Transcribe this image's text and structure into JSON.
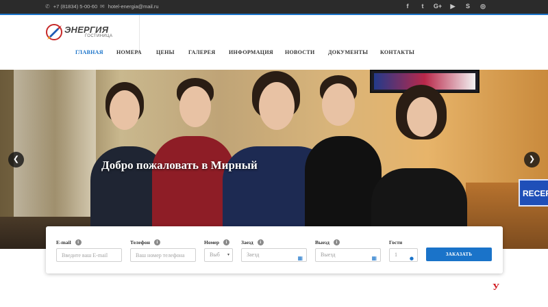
{
  "topbar": {
    "phone": "+7 (81834) 5-00-60",
    "email": "hotel-energia@mail.ru",
    "socials": [
      "f",
      "t",
      "G+",
      "▶",
      "S",
      "◎"
    ]
  },
  "logo": {
    "name": "ЭНЕРГИЯ",
    "subtitle": "ГОСТИНИЦА"
  },
  "nav": {
    "items": [
      "ГЛАВНАЯ",
      "НОМЕРА",
      "ЦЕНЫ",
      "ГАЛЕРЕЯ",
      "ИНФОРМАЦИЯ",
      "НОВОСТИ",
      "ДОКУМЕНТЫ",
      "КОНТАКТЫ"
    ],
    "active": "ГЛАВНАЯ"
  },
  "hero": {
    "title": "Добро пожаловать в Мирный",
    "reception_sign": "RECEP"
  },
  "booking": {
    "email_label": "E-mail",
    "email_placeholder": "Введите ваш E-mail",
    "phone_label": "Телефон",
    "phone_placeholder": "Ваш номер телефона",
    "room_label": "Номер",
    "room_value": "Выб",
    "checkin_label": "Заезд",
    "checkin_placeholder": "Заезд",
    "checkout_label": "Выезд",
    "checkout_placeholder": "Выезд",
    "guests_label": "Гости",
    "guests_value": "1",
    "order_button": "ЗАКАЗАТЬ"
  },
  "below": {
    "text": "У"
  },
  "colors": {
    "accent": "#1a73c9",
    "topbar": "#2b2b2b",
    "red_text": "#d0161c"
  }
}
